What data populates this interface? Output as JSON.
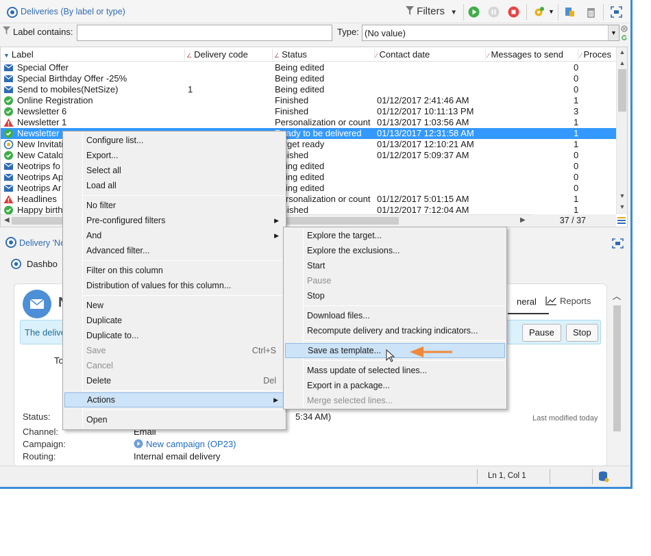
{
  "toolbar": {
    "title": "Deliveries (By label or type)",
    "filters_label": "Filters"
  },
  "filterbar": {
    "label_contains": "Label contains:",
    "label_value": "",
    "type_label": "Type:",
    "type_value": "(No value)"
  },
  "list": {
    "columns": [
      "Label",
      "Delivery code",
      "Status",
      "Contact date",
      "Messages to send",
      "Proces"
    ],
    "rows": [
      {
        "icon": "envelope-icon",
        "label": "Special Offer",
        "code": "",
        "status": "Being edited",
        "date": "",
        "messages": "0"
      },
      {
        "icon": "envelope-icon",
        "label": "Special Birthday Offer -25%",
        "code": "",
        "status": "Being edited",
        "date": "",
        "messages": "0"
      },
      {
        "icon": "envelope-icon",
        "label": "Send to mobiles(NetSize)",
        "code": "1",
        "status": "Being edited",
        "date": "",
        "messages": "0"
      },
      {
        "icon": "check-icon",
        "label": "Online Registration",
        "code": "",
        "status": "Finished",
        "date": "01/12/2017 2:41:46 AM",
        "messages": "1"
      },
      {
        "icon": "check-icon",
        "label": "Newsletter 6",
        "code": "",
        "status": "Finished",
        "date": "01/12/2017 10:11:13 PM",
        "messages": "3"
      },
      {
        "icon": "warning-icon",
        "label": "Newsletter 1",
        "code": "",
        "status": "Personalization or count ...",
        "date": "01/13/2017 1:03:56 AM",
        "messages": "1"
      },
      {
        "icon": "check-icon",
        "label": "Newsletter",
        "code": "",
        "status": "Ready to be delivered",
        "date": "01/13/2017 12:31:58 AM",
        "messages": "1",
        "selected": true
      },
      {
        "icon": "target-icon",
        "label": "New Invitati",
        "code": "",
        "status": "Target ready",
        "date": "01/13/2017 12:10:21 AM",
        "messages": "1"
      },
      {
        "icon": "check-icon",
        "label": "New Catalo",
        "code": "",
        "status": "Finished",
        "date": "01/12/2017 5:09:37 AM",
        "messages": "0"
      },
      {
        "icon": "envelope-icon",
        "label": "Neotrips fo",
        "code": "",
        "status": "Being edited",
        "date": "",
        "messages": "0"
      },
      {
        "icon": "envelope-icon",
        "label": "Neotrips Ap",
        "code": "",
        "status": "Being edited",
        "date": "",
        "messages": "0"
      },
      {
        "icon": "envelope-icon",
        "label": "Neotrips Ar",
        "code": "",
        "status": "Being edited",
        "date": "",
        "messages": "0"
      },
      {
        "icon": "warning-icon",
        "label": "Headlines",
        "code": "",
        "status": "Personalization or count ...",
        "date": "01/12/2017 5:01:15 AM",
        "messages": "1"
      },
      {
        "icon": "check-icon",
        "label": "Happy birth",
        "code": "",
        "status": "Finished",
        "date": "01/12/2017 7:12:04 AM",
        "messages": "1"
      }
    ],
    "count": "37 / 37"
  },
  "panel": {
    "title": "Delivery 'Ne",
    "tab_dashboard": "Dashbo",
    "card_initial": "N",
    "tab_general": "neral",
    "tab_reports": "Reports",
    "banner_text": "The delive",
    "pause_label": "Pause",
    "stop_label": "Stop",
    "to_label": "To",
    "status_label": "Status:",
    "status_value": "5:34 AM)",
    "channel_label": "Channel:",
    "channel_value": "Email",
    "campaign_label": "Campaign:",
    "campaign_value": "New campaign (OP23)",
    "routing_label": "Routing:",
    "routing_value": "Internal email delivery",
    "last_modified": "Last modified today"
  },
  "statusbar": {
    "position": "Ln 1, Col 1"
  },
  "context_menu": {
    "items": [
      {
        "label": "Configure list...",
        "enabled": true
      },
      {
        "label": "Export...",
        "enabled": true
      },
      {
        "label": "Select all",
        "enabled": true
      },
      {
        "label": "Load all",
        "enabled": true
      },
      {
        "label": "No filter",
        "enabled": true
      },
      {
        "label": "Pre-configured filters",
        "enabled": true,
        "submenu": true
      },
      {
        "label": "And",
        "enabled": true,
        "submenu": true
      },
      {
        "label": "Advanced filter...",
        "enabled": true
      },
      {
        "label": "Filter on this column",
        "enabled": true
      },
      {
        "label": "Distribution of values for this column...",
        "enabled": true
      },
      {
        "label": "New",
        "enabled": true
      },
      {
        "label": "Duplicate",
        "enabled": true
      },
      {
        "label": "Duplicate to...",
        "enabled": true
      },
      {
        "label": "Save",
        "enabled": false,
        "shortcut": "Ctrl+S"
      },
      {
        "label": "Cancel",
        "enabled": false
      },
      {
        "label": "Delete",
        "enabled": true,
        "shortcut": "Del"
      },
      {
        "label": "Actions",
        "enabled": true,
        "submenu": true,
        "highlighted": true
      },
      {
        "label": "Open",
        "enabled": true
      }
    ]
  },
  "actions_submenu": {
    "items": [
      {
        "label": "Explore the target...",
        "enabled": true
      },
      {
        "label": "Explore the exclusions...",
        "enabled": true
      },
      {
        "label": "Start",
        "enabled": true
      },
      {
        "label": "Pause",
        "enabled": false
      },
      {
        "label": "Stop",
        "enabled": true
      },
      {
        "label": "Download files...",
        "enabled": true
      },
      {
        "label": "Recompute delivery and tracking indicators...",
        "enabled": true
      },
      {
        "label": "Save as template...",
        "enabled": true,
        "highlighted": true
      },
      {
        "label": "Mass update of selected lines...",
        "enabled": true
      },
      {
        "label": "Export in a package...",
        "enabled": true
      },
      {
        "label": "Merge selected lines...",
        "enabled": false
      }
    ]
  },
  "colors": {
    "accent": "#2f6cb3",
    "selection": "#3399ff",
    "annotation_arrow": "#f0883a",
    "menu_highlight": "#cde3f7"
  }
}
